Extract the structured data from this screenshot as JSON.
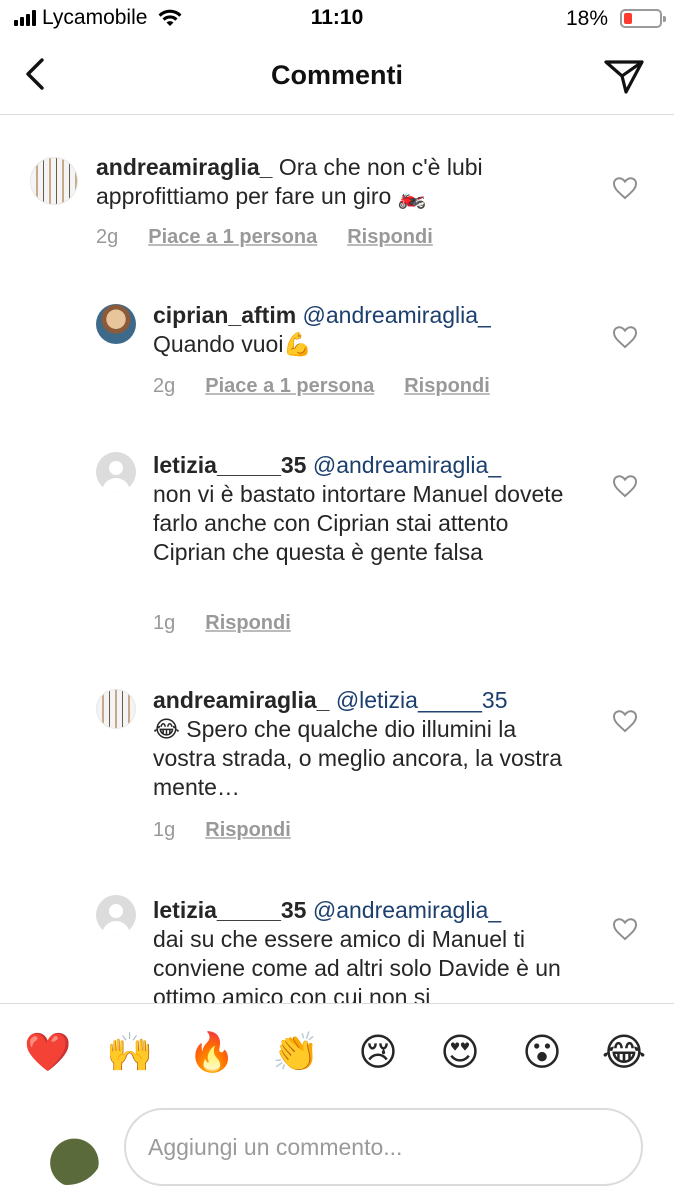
{
  "status_bar": {
    "carrier": "Lycamobile",
    "time": "11:10",
    "battery": "18%",
    "battery_level": 0.18,
    "battery_color": "#ff3b30"
  },
  "header": {
    "title": "Commenti",
    "back_icon": "chevron-left-icon",
    "send_icon": "paper-plane-icon"
  },
  "comments": [
    {
      "username": "andreamiraglia_",
      "mention": "",
      "text": "Ora che non c'è lubi approfittiamo per fare un giro 🏍️",
      "age": "2g",
      "likes": "Piace a 1 persona",
      "reply": "Rispondi"
    },
    {
      "username": "ciprian_aftim",
      "mention": "@andreamiraglia_",
      "text": "Quando vuoi💪",
      "age": "2g",
      "likes": "Piace a 1 persona",
      "reply": "Rispondi"
    },
    {
      "username": "letizia_____35",
      "mention": "@andreamiraglia_",
      "text": "non vi è bastato intortare Manuel dovete farlo anche con Ciprian stai attento Ciprian che questa è gente falsa",
      "age": "1g",
      "reply": "Rispondi"
    },
    {
      "username": "andreamiraglia_",
      "mention": "@letizia_____35",
      "text": "😂 Spero che qualche dio illumini la vostra strada, o meglio ancora, la vostra mente…",
      "age": "1g",
      "reply": "Rispondi"
    },
    {
      "username": "letizia_____35",
      "mention": "@andreamiraglia_",
      "text": "dai su che essere amico di Manuel ti conviene come ad altri solo Davide è un ottimo amico con cui non si"
    }
  ],
  "emoji_bar": [
    "❤️",
    "🙌",
    "🔥",
    "👏",
    "😢",
    "😍",
    "😮",
    "😂"
  ],
  "comment_input": {
    "placeholder": "Aggiungi un commento..."
  },
  "colors": {
    "mention": "#1c3f6e",
    "meta_gray": "#999999",
    "divider": "#dbdbdb"
  }
}
